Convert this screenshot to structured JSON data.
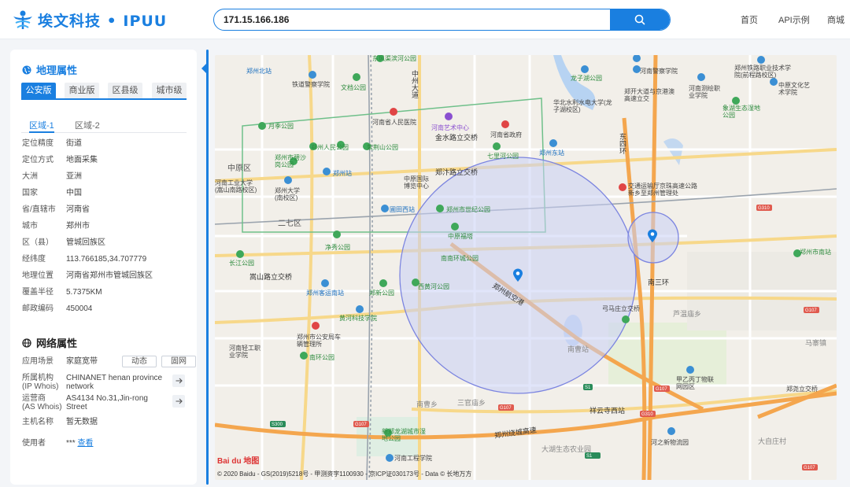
{
  "header": {
    "logo_text": "埃文科技 • IPUU",
    "search_value": "171.15.166.186",
    "nav": [
      "首页",
      "API示例",
      "商城"
    ]
  },
  "geo": {
    "title": "地理属性",
    "version_tabs": [
      "公安版",
      "商业版",
      "区县级",
      "城市级"
    ],
    "area_tabs": [
      "区域-1",
      "区域-2"
    ],
    "rows": [
      {
        "k": "定位精度",
        "v": "街道"
      },
      {
        "k": "定位方式",
        "v": "地面采集"
      },
      {
        "k": "大洲",
        "v": "亚洲"
      },
      {
        "k": "国家",
        "v": "中国"
      },
      {
        "k": "省/直辖市",
        "v": "河南省"
      },
      {
        "k": "城市",
        "v": "郑州市"
      },
      {
        "k": "区（县）",
        "v": "管城回族区"
      },
      {
        "k": "经纬度",
        "v": "113.766185,34.707779"
      },
      {
        "k": "地理位置",
        "v": "河南省郑州市管城回族区"
      },
      {
        "k": "覆盖半径",
        "v": "5.7375KM"
      },
      {
        "k": "邮政编码",
        "v": "450004"
      }
    ]
  },
  "net": {
    "title": "网络属性",
    "scene_k": "应用场景",
    "scene_v": "家庭宽带",
    "btn_dynamic": "动态",
    "btn_fixed": "固网",
    "org_k1": "所属机构",
    "org_k2": "(IP Whois)",
    "org_v1": "CHINANET henan province",
    "org_v2": "network",
    "isp_k1": "运营商",
    "isp_k2": "(AS Whois)",
    "isp_v1": "AS4134 No.31,Jin-rong",
    "isp_v2": "Street",
    "host_k": "主机名称",
    "host_v": "暂无数据",
    "user_k": "使用者",
    "user_v": "***",
    "user_link": "查看"
  },
  "map": {
    "baidu_logo": "Bai du 地图",
    "copyright": "© 2020 Baidu - GS(2019)5218号 - 甲测资字1100930 - 京ICP证030173号 - Data © 长地万方",
    "labels": {
      "l01": "郑州北站",
      "l02": "铁道警察学院",
      "l03": "东风渠滨河公园",
      "l04": "中州大道",
      "l05": "文档公园",
      "l06": "龙子湖公园",
      "l07": "河南警察学院",
      "l08": "郑州铁路职业技术学院(前程路校区)",
      "l09": "郑开大道与京港澳高速立交",
      "l10": "华北水利水电大学(龙子湖校区)",
      "l11": "河南省人民医院",
      "l12": "河南艺术中心",
      "l13": "河南省政府",
      "l14": "金水路立交桥",
      "l15": "七里河公园",
      "l16": "郑州东站",
      "l17": "东四环",
      "l18": "月季公园",
      "l19": "郑州人民公园",
      "l20": "紫荆山公园",
      "l21": "郑州市碧沙岗公园",
      "l22": "郑州站",
      "l23": "郑汴路立交桥",
      "l24": "中原国际博览中心",
      "l25": "交通运输厅京珠高速公路新乡至郑州管理处",
      "l26": "河南工业大学(嵩山南路校区)",
      "l27": "郑州大学(南校区)",
      "l28": "二七区",
      "l29": "圃田西站",
      "l30": "郑州市世纪公园",
      "l31": "中原区",
      "l32": "中原福塔",
      "l33": "南南环城公园",
      "l34": "净秀公园",
      "l35": "长江公园",
      "l36": "嵩山路立交桥",
      "l37": "郑州客运南站",
      "l38": "郑新公园",
      "l39": "西黄河公园",
      "l40": "郑州航空港",
      "l41": "南三环",
      "l42": "弓马庄立交桥",
      "l43": "芦温庙乡",
      "l44": "黄河科技学院",
      "l45": "郑州市公安局车辆管理所",
      "l46": "河南轻工职业学院",
      "l47": "南环公园",
      "l48": "南曹站",
      "l49": "甲乙丙丁物联网园区",
      "l50": "郑尧立交桥",
      "l51": "祥云寺西站",
      "l52": "郑州绕城高速",
      "l53": "新郑龙湖城市湿地公园",
      "l54": "河南工程学院",
      "l55": "大湖生态农业园",
      "l56": "河之新物流园",
      "l57": "大自庄村",
      "l58": "象湖生态湿地公园",
      "l59": "中原文化艺术学院",
      "l60": "河南测绘职业学院",
      "l61": "郑州市南站",
      "l62": "马寨镇",
      "l63": "南曹乡",
      "l64": "三官庙乡"
    }
  },
  "colors": {
    "accent": "#1a7fe0",
    "circle_fill": "#c9d0f5",
    "circle_stroke": "#7b84e0"
  }
}
